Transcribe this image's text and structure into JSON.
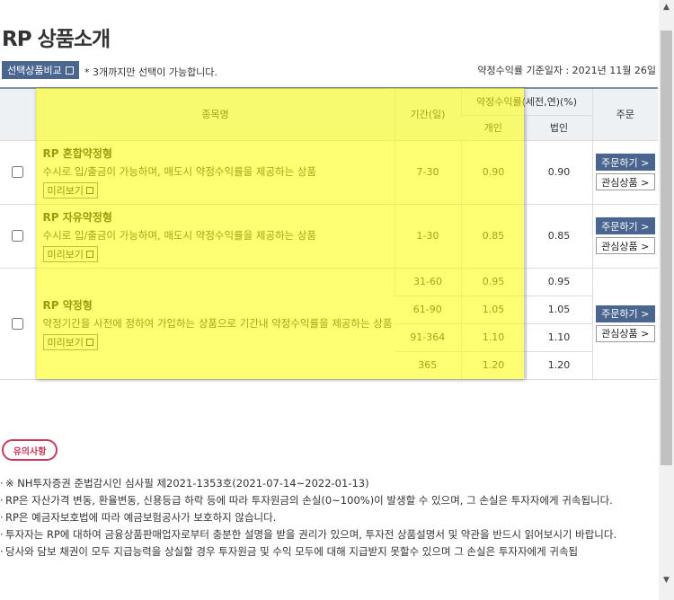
{
  "page": {
    "title": "RP 상품소개"
  },
  "toolbar": {
    "compare_label": "선택상품비교",
    "compare_note": "* 3개까지만 선택이 가능합니다.",
    "base_date": "약정수익률 기준일자 : 2021년 11월 26일"
  },
  "table": {
    "headers": {
      "name": "종목명",
      "period": "기간(일)",
      "rate_group": "약정수익률(세전,연)(%)",
      "individual": "개인",
      "corporate": "법인",
      "order": "주문"
    },
    "preview_label": "미리보기",
    "order_label": "주문하기 >",
    "fav_label": "관심상품 >",
    "products": [
      {
        "name": "RP 혼합약정형",
        "desc": "수시로 입/출금이 가능하며, 매도시 약정수익률을 제공하는 상품",
        "tiers": [
          {
            "period": "7-30",
            "individual": "0.90",
            "corporate": "0.90"
          }
        ]
      },
      {
        "name": "RP 자유약정형",
        "desc": "수시로 입/출금이 가능하며, 매도시 약정수익률을 제공하는 상품",
        "tiers": [
          {
            "period": "1-30",
            "individual": "0.85",
            "corporate": "0.85"
          }
        ]
      },
      {
        "name": "RP 약정형",
        "desc": "약정기간을 사전에 정하여 가입하는 상품으로 기간내 약정수익률을 제공하는 상품",
        "tiers": [
          {
            "period": "31-60",
            "individual": "0.95",
            "corporate": "0.95"
          },
          {
            "period": "61-90",
            "individual": "1.05",
            "corporate": "1.05"
          },
          {
            "period": "91-364",
            "individual": "1.10",
            "corporate": "1.10"
          },
          {
            "period": "365",
            "individual": "1.20",
            "corporate": "1.20"
          }
        ]
      }
    ]
  },
  "caution": {
    "badge": "유의사항",
    "notes": [
      "※ NH투자증권 준법감시인 심사필 제2021-1353호(2021-07-14~2022-01-13)",
      "RP은 자산가격 변동, 환율변동, 신용등급 하락 등에 따라 투자원금의 손실(0~100%)이 발생할 수 있으며, 그 손실은 투자자에게 귀속됩니다.",
      "RP은 예금자보호법에 따라 예금보험공사가 보호하지 않습니다.",
      "투자자는 RP에 대하여 금융상품판매업자로부터 충분한 설명을 받을 권리가 있으며, 투자전 상품설명서 및 약관을 반드시 읽어보시기 바랍니다.",
      "당사와 담보 채권이 모두 지급능력을 상실할 경우 투자원금 및 수익 모두에 대해 지급받지 못할수 있으며 그 손실은 투자자에게 귀속됩"
    ]
  },
  "colors": {
    "button_blue": "#4a6690",
    "highlight": "#ffff00",
    "caution_red": "#c9395a"
  },
  "icons": {
    "popup": "popup-window-icon",
    "scroll_up": "scroll-up-arrow-icon",
    "scroll_down": "scroll-down-arrow-icon"
  }
}
